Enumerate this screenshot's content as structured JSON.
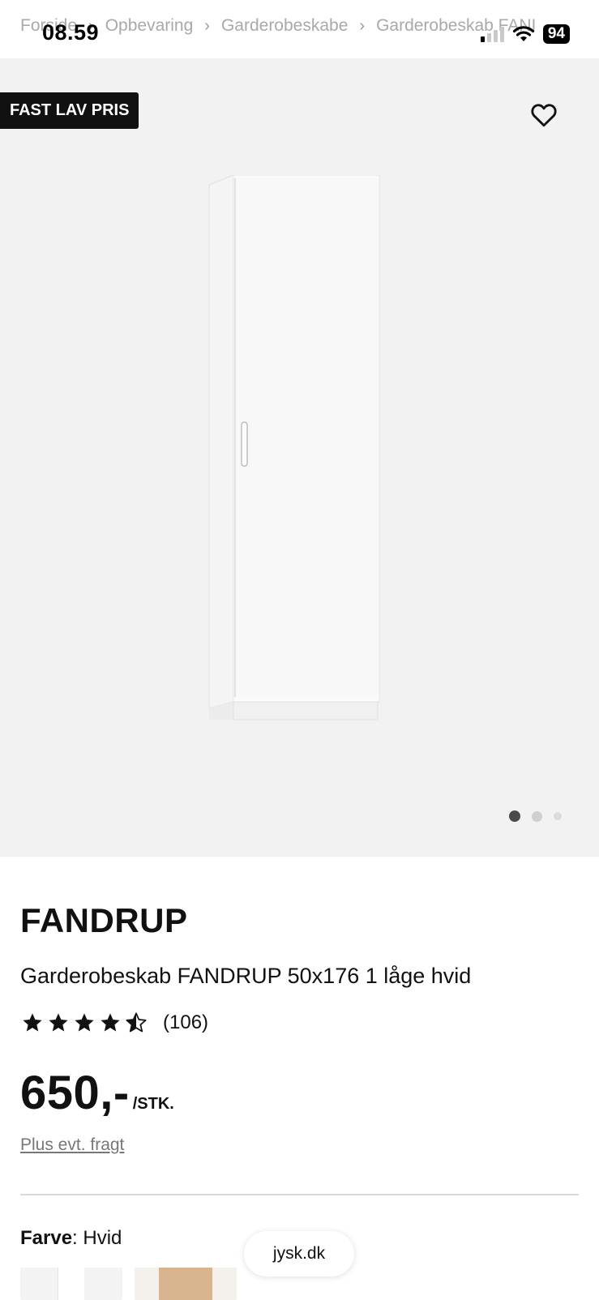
{
  "status_bar": {
    "time": "08.59",
    "battery": "94"
  },
  "breadcrumb": [
    "Forside",
    "Opbevaring",
    "Garderobeskabe",
    "Garderobeskab FANI"
  ],
  "gallery": {
    "badge": "FAST LAV PRIS",
    "image_count": 3,
    "active_index": 0
  },
  "product": {
    "brand": "FANDRUP",
    "name": "Garderobeskab FANDRUP 50x176 1 låge hvid",
    "rating": 4.5,
    "review_count": "(106)",
    "price": "650,-",
    "unit": "/STK.",
    "shipping_note": "Plus evt. fragt"
  },
  "color": {
    "label": "Farve",
    "value": "Hvid"
  },
  "browser": {
    "url": "jysk.dk"
  },
  "icons": {
    "favorite": "heart-outline-icon",
    "star": "star-icon"
  }
}
